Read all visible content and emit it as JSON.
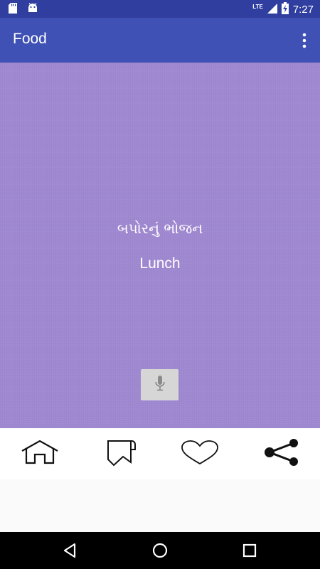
{
  "status_bar": {
    "time": "7:27",
    "network": "LTE",
    "icons": [
      "sd-card-icon",
      "android-icon",
      "signal-icon",
      "battery-charging-icon"
    ]
  },
  "app_bar": {
    "title": "Food",
    "overflow_icon": "more-vert-icon"
  },
  "card": {
    "native_text": "બપોરનું ભોજન",
    "english_text": "Lunch",
    "mic_icon": "microphone-icon"
  },
  "bottom_nav": {
    "items": [
      "home-icon",
      "bookmark-icon",
      "heart-icon",
      "share-icon"
    ]
  },
  "system_nav": [
    "back-icon",
    "home-circle-icon",
    "recents-icon"
  ],
  "colors": {
    "status_bar": "#303f9f",
    "app_bar": "#3f51b5",
    "card_background": "#9f88d1"
  }
}
